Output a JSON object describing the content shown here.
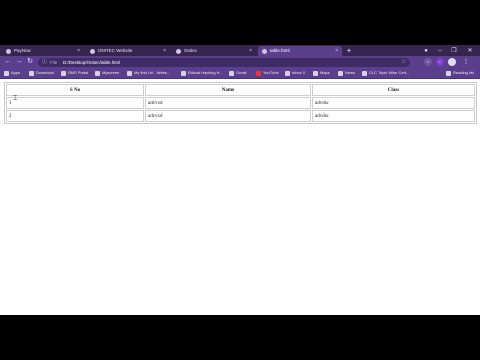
{
  "browser": {
    "tabs": [
      {
        "label": "PayNow",
        "active": false
      },
      {
        "label": "ONITEC Website",
        "active": false
      },
      {
        "label": "Onitec",
        "active": false
      },
      {
        "label": "table.html",
        "active": true
      }
    ],
    "new_tab_glyph": "+",
    "address": {
      "scheme": "File",
      "url": "D:/Desktop/Onitec/table.html"
    },
    "bookmarks": [
      "Apps",
      "Download",
      "SMS Portal",
      "Myscreen",
      "My first Url - Webs...",
      "Ethical Hacking fr...",
      "Gmail",
      "YouTube",
      "Inbox 0",
      "Maps",
      "News",
      "CLC Topic Wise Cert...",
      "Reading list"
    ]
  },
  "table": {
    "headers": [
      "S No",
      "Name",
      "Class"
    ],
    "rows": [
      {
        "sno": "1",
        "name": "adcvxd",
        "class": "advdsc"
      },
      {
        "sno": "2",
        "name": "adcvxd",
        "class": "advdsc"
      }
    ]
  },
  "colors": {
    "frame": "#35254f",
    "toolbar": "#5b3f8c",
    "letterbox": "#000000"
  },
  "icons": [
    "back-icon",
    "forward-icon",
    "reload-icon",
    "info-icon",
    "star-icon",
    "close-icon",
    "menu-icon",
    "profile-icon",
    "mouse-pointer-icon"
  ]
}
